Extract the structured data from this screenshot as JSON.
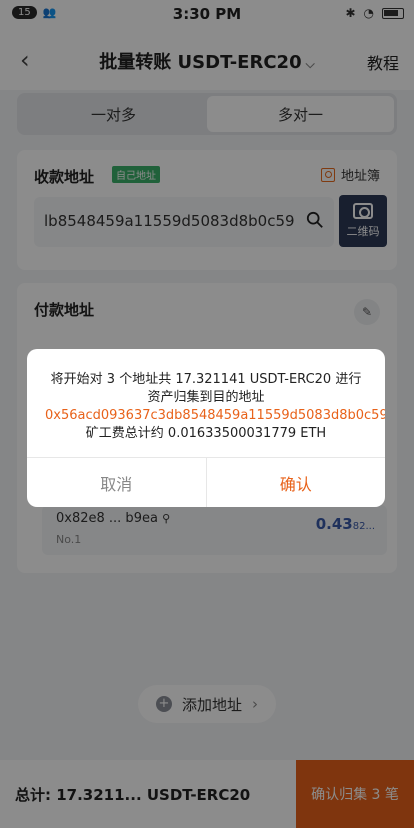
{
  "statusbar": {
    "notif_count": "15",
    "time": "3:30 PM"
  },
  "header": {
    "title": "批量转账 USDT-ERC20",
    "tutorial": "教程"
  },
  "tabs": [
    {
      "label": "一对多"
    },
    {
      "label": "多对一"
    }
  ],
  "receive": {
    "title": "收款地址",
    "own_tag": "自己地址",
    "address_book": "地址簿",
    "address_value": "lb8548459a11559d5083d8b0c59",
    "qr_label": "二维码"
  },
  "payment": {
    "title": "付款地址",
    "rows": [
      {
        "address": "0x82e8 ... b9ea",
        "no": "No.1",
        "amount_main": "0.43",
        "amount_small": "82..."
      }
    ]
  },
  "add_address": "添加地址",
  "footer": {
    "total": "总计: 17.3211... USDT-ERC20",
    "confirm": "确认归集 3 笔"
  },
  "dialog": {
    "msg_part1": "将开始对 3 个地址共 17.321141 USDT-ERC20 进行资产归集到目的地址 ",
    "msg_address": "0x56acd093637c3db8548459a11559d5083d8b0c59",
    "msg_part2": "，矿工费总计约 0.01633500031779 ETH",
    "cancel": "取消",
    "confirm": "确认"
  },
  "colors": {
    "accent": "#e8621a",
    "dark_button": "#2c3a56",
    "tag_green": "#3bb16a"
  }
}
